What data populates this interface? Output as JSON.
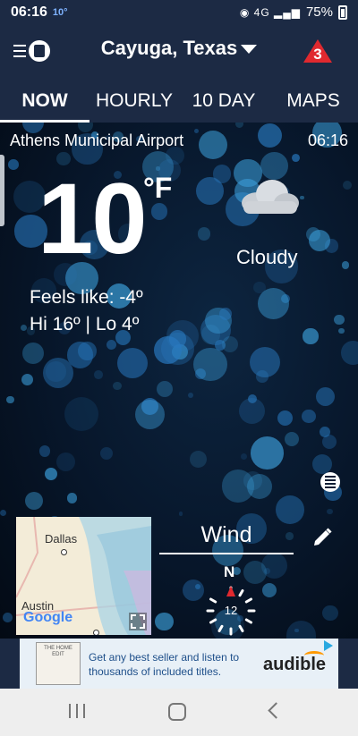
{
  "status_bar": {
    "time": "06:16",
    "temp": "10°",
    "network_icons": "◉ 4G ▂▄▆",
    "battery": "75%"
  },
  "header": {
    "location": "Cayuga, Texas",
    "alert_count": "3",
    "menu_icon": "hamburger-icon",
    "logo_icon": "app-logo-icon",
    "alert_icon": "warning-triangle-icon"
  },
  "tabs": [
    {
      "label": "NOW",
      "active": true
    },
    {
      "label": "HOURLY",
      "active": false
    },
    {
      "label": "10 DAY",
      "active": false
    },
    {
      "label": "MAPS",
      "active": false
    }
  ],
  "current": {
    "station": "Athens Municipal Airport",
    "obs_time": "06:16",
    "temp": "10",
    "unit": "°F",
    "condition": "Cloudy",
    "condition_icon": "cloud-icon",
    "feels_like": "Feels like: -4º",
    "hi_lo": "Hi 16º | Lo 4º"
  },
  "map": {
    "city_dallas": "Dallas",
    "city_austin": "Austin",
    "attribution": "Google",
    "expand_icon": "expand-icon"
  },
  "wind": {
    "title": "Wind",
    "direction_label": "N",
    "speed": "12",
    "edit_icon": "pencil-icon"
  },
  "ad": {
    "book_text": "THE HOME EDIT",
    "text": "Get any best seller and listen to thousands of included titles.",
    "brand": "audible"
  },
  "colors": {
    "header_bg": "#1c2a44",
    "alert_red": "#e0292f",
    "ad_text": "#1e4f8a"
  }
}
